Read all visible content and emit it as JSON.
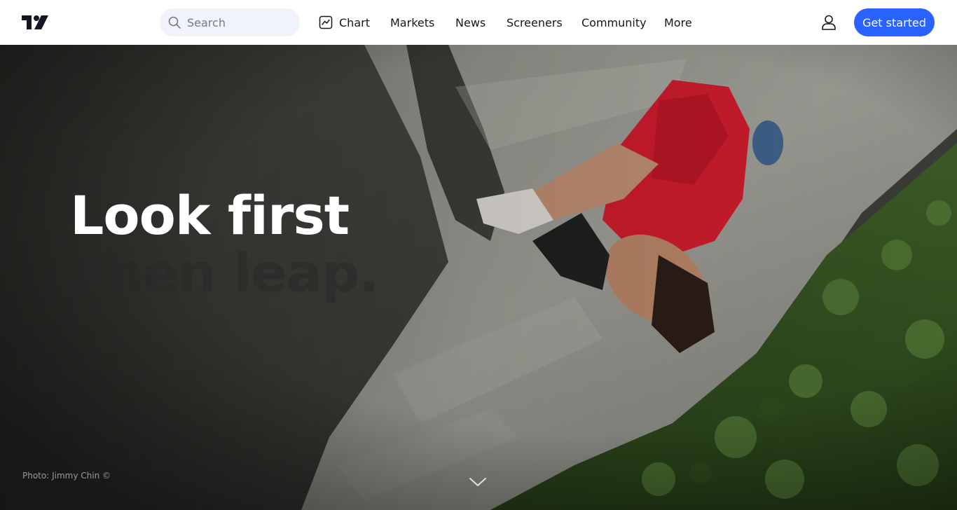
{
  "header": {
    "logo_text": "TV",
    "search": {
      "placeholder": "Search"
    },
    "nav": {
      "chart": "Chart",
      "markets": "Markets",
      "news": "News",
      "screeners": "Screeners",
      "community": "Community",
      "more": "More"
    },
    "cta_label": "Get started"
  },
  "hero": {
    "headline_line1": "Look first",
    "headline_line2": "Then leap.",
    "photo_credit": "Photo: Jimmy Chin ©"
  },
  "icons": {
    "logo": "tradingview-logo-icon",
    "search": "search-icon",
    "chart": "chart-icon",
    "user": "user-icon",
    "scroll": "chevron-down-icon"
  },
  "colors": {
    "accent": "#2962ff",
    "text": "#131722",
    "search_bg": "#f0f3fa",
    "placeholder": "#787b86"
  }
}
